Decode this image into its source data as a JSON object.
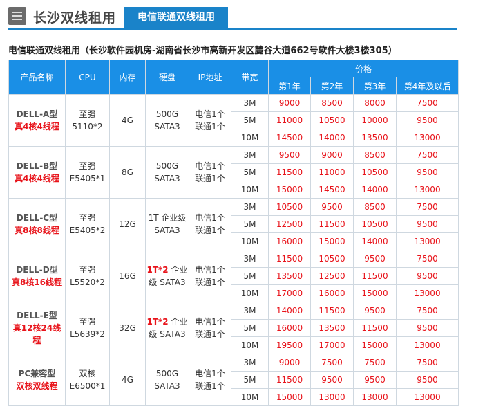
{
  "header": {
    "title": "长沙双线租用",
    "tab_label": "电信联通双线租用"
  },
  "subtitle": "电信联通双线租用（长沙软件园机房-湖南省长沙市高新开发区麓谷大道662号软件大楼3楼305）",
  "table": {
    "headers": {
      "product": "产品名称",
      "cpu": "CPU",
      "memory": "内存",
      "disk": "硬盘",
      "ip": "IP地址",
      "bandwidth": "带宽",
      "price": "价格",
      "years": [
        "第1年",
        "第2年",
        "第3年",
        "第4年及以后"
      ]
    },
    "products": [
      {
        "name": "DELL-A型",
        "cores": "真4核4线程",
        "cpu_top": "至强",
        "cpu_bottom": "5110*2",
        "memory": "4G",
        "disk_top": "500G",
        "disk_bottom": "SATA3",
        "ip_top": "电信1个",
        "ip_bottom": "联通1个",
        "rows": [
          {
            "bw": "3M",
            "prices": [
              "9000",
              "8500",
              "8000",
              "7500"
            ]
          },
          {
            "bw": "5M",
            "prices": [
              "11000",
              "10500",
              "10000",
              "9500"
            ]
          },
          {
            "bw": "10M",
            "prices": [
              "14500",
              "14000",
              "13500",
              "13000"
            ]
          }
        ]
      },
      {
        "name": "DELL-B型",
        "cores": "真4核4线程",
        "cpu_top": "至强",
        "cpu_bottom": "E5405*1",
        "memory": "8G",
        "disk_top": "500G",
        "disk_bottom": "SATA3",
        "ip_top": "电信1个",
        "ip_bottom": "联通1个",
        "rows": [
          {
            "bw": "3M",
            "prices": [
              "9500",
              "9000",
              "8500",
              "7500"
            ]
          },
          {
            "bw": "5M",
            "prices": [
              "11500",
              "11000",
              "10500",
              "9500"
            ]
          },
          {
            "bw": "10M",
            "prices": [
              "15000",
              "14500",
              "14000",
              "13000"
            ]
          }
        ]
      },
      {
        "name": "DELL-C型",
        "cores": "真8核8线程",
        "cpu_top": "至强",
        "cpu_bottom": "E5405*2",
        "memory": "12G",
        "disk_top": "1T 企业级",
        "disk_bottom": "SATA3",
        "ip_top": "电信1个",
        "ip_bottom": "联通1个",
        "rows": [
          {
            "bw": "3M",
            "prices": [
              "10500",
              "9500",
              "8500",
              "7500"
            ]
          },
          {
            "bw": "5M",
            "prices": [
              "12500",
              "11500",
              "10500",
              "9500"
            ]
          },
          {
            "bw": "10M",
            "prices": [
              "16000",
              "15000",
              "14000",
              "13000"
            ]
          }
        ]
      },
      {
        "name": "DELL-D型",
        "cores": "真8核16线程",
        "cpu_top": "至强",
        "cpu_bottom": "L5520*2",
        "memory": "16G",
        "disk_top_red": "1T*2",
        "disk_top_rest": " 企业",
        "disk_bottom": "级 SATA3",
        "ip_top": "电信1个",
        "ip_bottom": "联通1个",
        "rows": [
          {
            "bw": "3M",
            "prices": [
              "11500",
              "10500",
              "9500",
              "7500"
            ]
          },
          {
            "bw": "5M",
            "prices": [
              "13500",
              "12500",
              "11500",
              "9500"
            ]
          },
          {
            "bw": "10M",
            "prices": [
              "17000",
              "16000",
              "15000",
              "13000"
            ]
          }
        ]
      },
      {
        "name": "DELL-E型",
        "cores": "真12核24线程",
        "cpu_top": "至强",
        "cpu_bottom": "L5639*2",
        "memory": "32G",
        "disk_top_red": "1T*2",
        "disk_top_rest": " 企业",
        "disk_bottom": "级 SATA3",
        "ip_top": "电信1个",
        "ip_bottom": "联通1个",
        "rows": [
          {
            "bw": "3M",
            "prices": [
              "14000",
              "11500",
              "9500",
              "7500"
            ]
          },
          {
            "bw": "5M",
            "prices": [
              "16000",
              "13500",
              "11500",
              "9500"
            ]
          },
          {
            "bw": "10M",
            "prices": [
              "19500",
              "17000",
              "15000",
              "13000"
            ]
          }
        ]
      },
      {
        "name": "PC兼容型",
        "cores": "双核双线程",
        "cpu_top": "双核",
        "cpu_bottom": "E6500*1",
        "memory": "4G",
        "disk_top": "500G",
        "disk_bottom": "SATA3",
        "ip_top": "电信1个",
        "ip_bottom": "联通1个",
        "rows": [
          {
            "bw": "3M",
            "prices": [
              "9000",
              "7500",
              "7500",
              "7500"
            ]
          },
          {
            "bw": "5M",
            "prices": [
              "11500",
              "9500",
              "9500",
              "9500"
            ]
          },
          {
            "bw": "10M",
            "prices": [
              "15000",
              "13000",
              "13000",
              "13000"
            ]
          }
        ]
      }
    ]
  }
}
